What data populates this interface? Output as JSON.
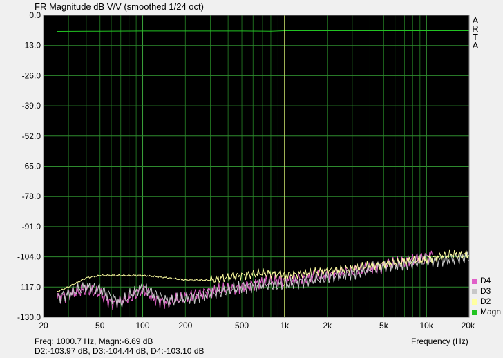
{
  "chart_data": {
    "type": "line",
    "title": "FR Magnitude dB V/V (smoothed 1/24 oct)",
    "xlabel": "Frequency (Hz)",
    "ylabel": "",
    "x_scale": "log",
    "xlim": [
      20,
      20000
    ],
    "ylim": [
      -130,
      0
    ],
    "grid": true,
    "legend_position": "right-bottom",
    "x_ticks": [
      {
        "value": 20,
        "label": "20"
      },
      {
        "value": 50,
        "label": "50"
      },
      {
        "value": 100,
        "label": "100"
      },
      {
        "value": 200,
        "label": "200"
      },
      {
        "value": 500,
        "label": "500"
      },
      {
        "value": 1000,
        "label": "1k"
      },
      {
        "value": 2000,
        "label": "2k"
      },
      {
        "value": 5000,
        "label": "5k"
      },
      {
        "value": 10000,
        "label": "10k"
      },
      {
        "value": 20000,
        "label": "20k"
      }
    ],
    "y_ticks": [
      0,
      -13,
      -26,
      -39,
      -52,
      -65,
      -78,
      -91,
      -104,
      -117,
      -130
    ],
    "y_tick_labels": [
      "0.0",
      "-13.0",
      "-26.0",
      "-39.0",
      "-52.0",
      "-65.0",
      "-78.0",
      "-91.0",
      "-104.0",
      "-117.0",
      "-130.0"
    ],
    "cursor_x": 1000.7,
    "series": [
      {
        "name": "Magn",
        "color": "#22c422",
        "x": [
          25,
          50,
          100,
          200,
          500,
          800,
          1000,
          2000,
          5000,
          10000,
          20000
        ],
        "y": [
          -7.0,
          -6.9,
          -6.8,
          -6.8,
          -6.8,
          -6.9,
          -6.7,
          -6.7,
          -6.7,
          -6.7,
          -6.7
        ]
      },
      {
        "name": "D2",
        "color": "#ffffa0",
        "x": [
          25,
          30,
          40,
          50,
          70,
          100,
          150,
          200,
          300,
          500,
          700,
          1000,
          1500,
          2000,
          3000,
          5000,
          7000,
          10000,
          15000,
          20000
        ],
        "y": [
          -119,
          -117,
          -113,
          -112,
          -112,
          -112,
          -113,
          -114,
          -114,
          -112,
          -111,
          -112,
          -111,
          -110,
          -109,
          -107,
          -106,
          -105,
          -103,
          -103
        ]
      },
      {
        "name": "D3",
        "color": "#c8c8c8",
        "x": [
          25,
          30,
          40,
          50,
          60,
          70,
          80,
          100,
          120,
          150,
          200,
          300,
          500,
          700,
          1000,
          1500,
          2000,
          3000,
          5000,
          7000,
          10000,
          15000,
          20000
        ],
        "y": [
          -121,
          -120,
          -117,
          -118,
          -121,
          -124,
          -121,
          -117,
          -120,
          -123,
          -122,
          -120,
          -117,
          -116,
          -116,
          -114,
          -113,
          -111,
          -108,
          -107,
          -106,
          -105,
          -104
        ]
      },
      {
        "name": "D4",
        "color": "#e060c8",
        "x": [
          25,
          30,
          40,
          50,
          60,
          80,
          100,
          120,
          150,
          200,
          300,
          500,
          700,
          1000,
          1500,
          2000,
          3000,
          5000,
          7000,
          10000,
          11000
        ],
        "y": [
          -122,
          -120,
          -118,
          -120,
          -124,
          -122,
          -118,
          -122,
          -124,
          -121,
          -119,
          -117,
          -115,
          -114,
          -113,
          -112,
          -110,
          -108,
          -106,
          -104,
          -103
        ]
      }
    ]
  },
  "brand": [
    "A",
    "R",
    "T",
    "A"
  ],
  "legend": [
    {
      "label": "D4",
      "color": "#e060c8"
    },
    {
      "label": "D3",
      "color": "#c8c8c8"
    },
    {
      "label": "D2",
      "color": "#ffffa0"
    },
    {
      "label": "Magn",
      "color": "#22c422"
    }
  ],
  "readout": {
    "line1": "Freq: 1000.7 Hz, Magn:-6.69 dB",
    "line2": "D2:-103.97 dB, D3:-104.44 dB, D4:-103.10 dB"
  }
}
